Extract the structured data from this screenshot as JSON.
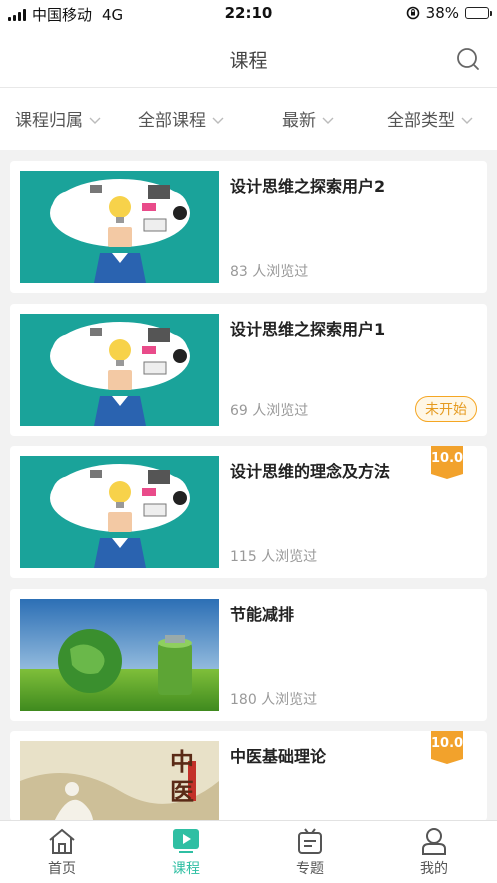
{
  "status_bar": {
    "carrier": "中国移动",
    "network": "4G",
    "time": "22:10",
    "battery": "38%",
    "battery_level": 0.38
  },
  "header": {
    "title": "课程",
    "search_icon": "search-icon"
  },
  "filters": [
    {
      "label": "课程归属"
    },
    {
      "label": "全部课程"
    },
    {
      "label": "最新"
    },
    {
      "label": "全部类型"
    }
  ],
  "courses": [
    {
      "title": "设计思维之探索用户2",
      "views": "83 人浏览过",
      "thumb": "design-thinking"
    },
    {
      "title": "设计思维之探索用户1",
      "views": "69 人浏览过",
      "thumb": "design-thinking",
      "status": "未开始"
    },
    {
      "title": "设计思维的理念及方法",
      "views": "115 人浏览过",
      "thumb": "design-thinking",
      "score": "10.0"
    },
    {
      "title": "节能减排",
      "views": "180 人浏览过",
      "thumb": "green-earth"
    },
    {
      "title": "中医基础理论",
      "views": "",
      "thumb": "chinese-medicine",
      "score": "10.0",
      "thumb_text": "中医"
    }
  ],
  "tabs": [
    {
      "label": "首页",
      "icon": "home-icon"
    },
    {
      "label": "课程",
      "icon": "play-icon",
      "active": true
    },
    {
      "label": "专题",
      "icon": "topic-icon"
    },
    {
      "label": "我的",
      "icon": "user-icon"
    }
  ],
  "colors": {
    "accent": "#2fbfa3",
    "badge_orange": "#f2a22c",
    "thumb_teal": "#1aa39a"
  }
}
